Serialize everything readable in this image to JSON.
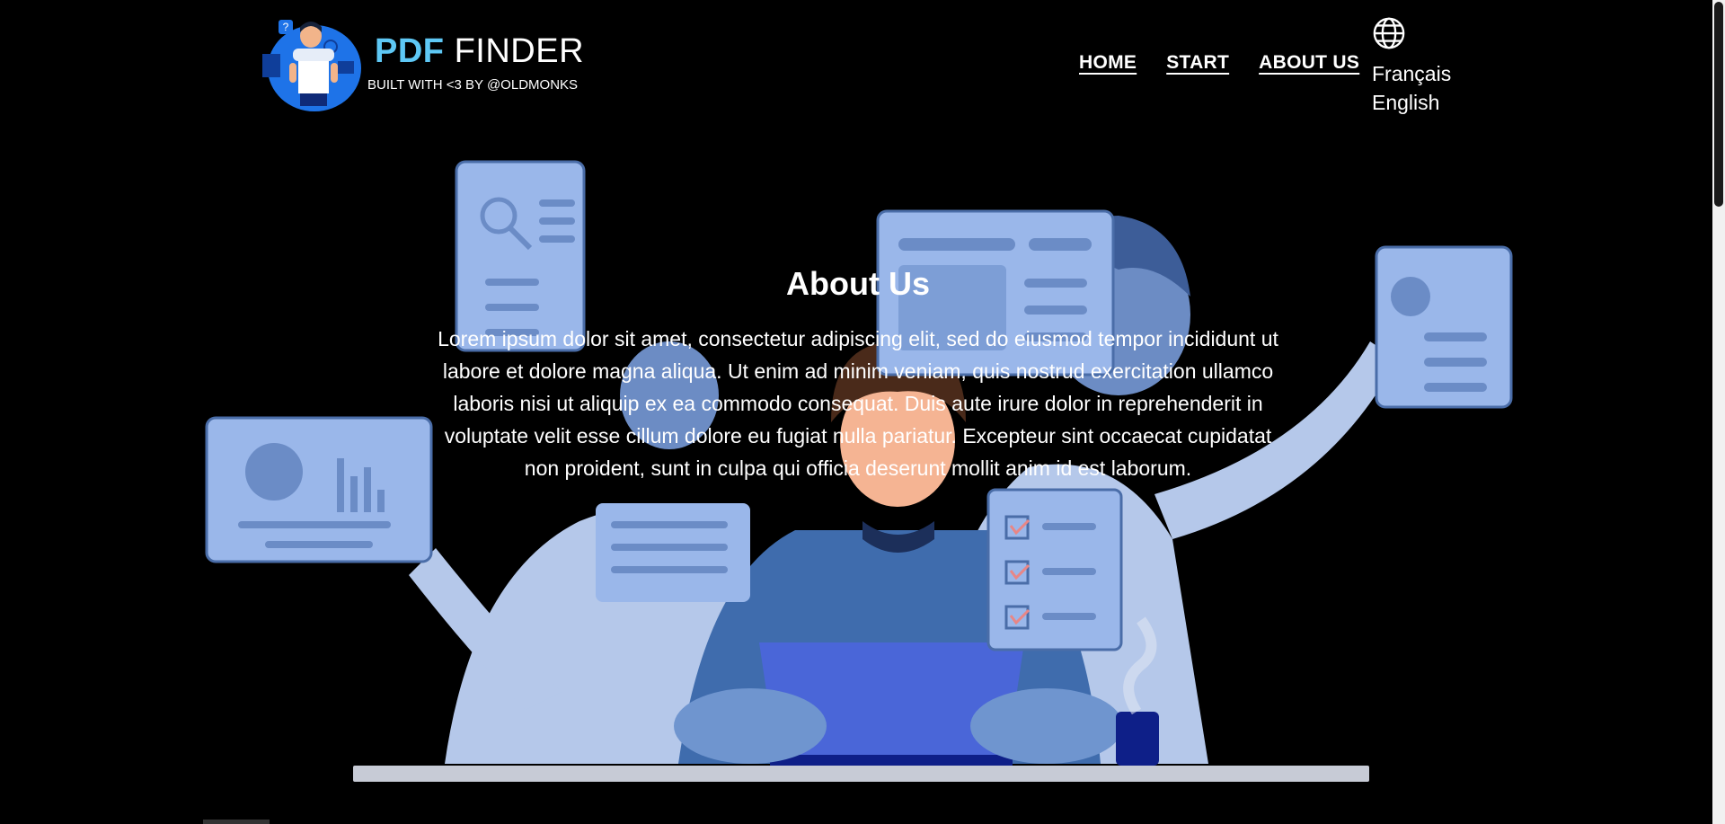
{
  "header": {
    "brand_primary": "PDF",
    "brand_secondary": "FINDER",
    "tagline": "BUILT WITH <3 BY @OLDMONKS",
    "logo_icon": "person-holding-document-icon"
  },
  "nav": {
    "items": [
      {
        "label": "HOME"
      },
      {
        "label": "START"
      },
      {
        "label": "ABOUT US"
      }
    ]
  },
  "language": {
    "icon": "globe-icon",
    "options": [
      "Français",
      "English"
    ]
  },
  "about": {
    "title": "About Us",
    "body": "Lorem ipsum dolor sit amet, consectetur adipiscing elit, sed do eiusmod tempor incididunt ut labore et dolore magna aliqua. Ut enim ad minim veniam, quis nostrud exercitation ullamco laboris nisi ut aliquip ex ea commodo consequat. Duis aute irure dolor in reprehenderit in voluptate velit esse cillum dolore eu fugiat nulla pariatur. Excepteur sint occaecat cupidatat non proident, sunt in culpa qui officia deserunt mollit anim id est laborum."
  },
  "colors": {
    "background": "#000000",
    "brand_accent": "#5ec8f5",
    "illustration_light": "#a4c0f0",
    "illustration_dark": "#4a6da8"
  }
}
